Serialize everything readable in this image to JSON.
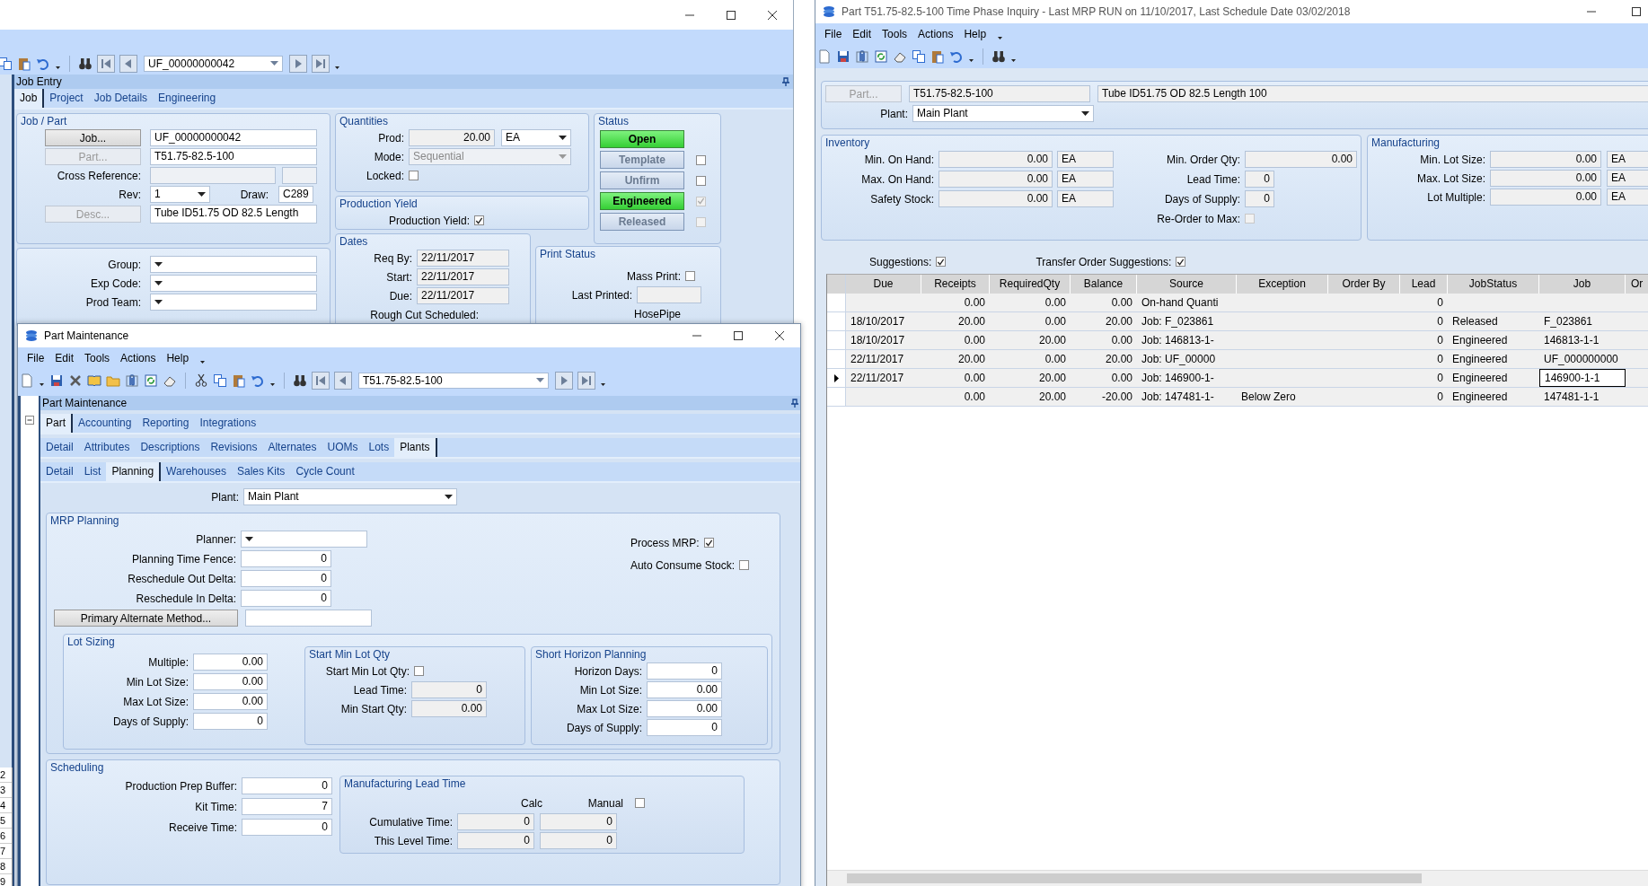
{
  "desktop": {
    "sheet_rows": [
      "2",
      "3",
      "4",
      "5",
      "6",
      "7",
      "8",
      "9"
    ]
  },
  "job_entry": {
    "record": "UF_00000000042",
    "panel_title": "Job Entry",
    "tabs": [
      {
        "label": "Job",
        "selected": true
      },
      {
        "label": "Project",
        "selected": false
      },
      {
        "label": "Job Details",
        "selected": false
      },
      {
        "label": "Engineering",
        "selected": false
      }
    ],
    "job_part": {
      "title": "Job / Part",
      "job_button": "Job...",
      "job": "UF_00000000042",
      "part_button": "Part...",
      "part": "T51.75-82.5-100",
      "cross_reference_label": "Cross Reference:",
      "rev_label": "Rev:",
      "rev": "1",
      "draw_label": "Draw:",
      "draw": "C289",
      "desc_button": "Desc...",
      "desc": "Tube ID51.75 OD 82.5 Length"
    },
    "codes": [
      {
        "label": "Group:"
      },
      {
        "label": "Exp Code:"
      },
      {
        "label": "Prod Team:"
      }
    ],
    "quantities": {
      "title": "Quantities",
      "prod_label": "Prod:",
      "prod": "20.00",
      "uom": "EA",
      "mode_label": "Mode:",
      "mode": "Sequential",
      "locked_label": "Locked:",
      "locked": false
    },
    "production_yield": {
      "title": "Production Yield",
      "label": "Production Yield:",
      "checked": true
    },
    "dates": {
      "title": "Dates",
      "fields": [
        {
          "label": "Req By:",
          "value": "22/11/2017"
        },
        {
          "label": "Start:",
          "value": "22/11/2017"
        },
        {
          "label": "Due:",
          "value": "22/11/2017"
        }
      ],
      "rough_cut_label": "Rough Cut Scheduled:"
    },
    "status": {
      "title": "Status",
      "buttons": [
        {
          "kind": "plain",
          "label": "Open",
          "on": true
        },
        {
          "kind": "checkbox",
          "label": "Template",
          "on": false,
          "checked": false,
          "disabled": false
        },
        {
          "kind": "checkbox",
          "label": "Unfirm",
          "on": false,
          "checked": false,
          "disabled": false
        },
        {
          "kind": "checkbox",
          "label": "Engineered",
          "on": true,
          "checked": true,
          "disabled": true
        },
        {
          "kind": "checkbox",
          "label": "Released",
          "on": false,
          "checked": false,
          "disabled": true
        }
      ]
    },
    "print_status": {
      "title": "Print Status",
      "mass_print_label": "Mass Print:",
      "mass_print": false,
      "last_printed_label": "Last Printed:",
      "hosepipe_label": "HosePipe"
    }
  },
  "part_maintenance": {
    "title": "Part Maintenance",
    "menu": [
      "File",
      "Edit",
      "Tools",
      "Actions",
      "Help"
    ],
    "record": "T51.75-82.5-100",
    "panel_title": "Part Maintenance",
    "tab_rows": [
      [
        {
          "label": "Part",
          "selected": true
        },
        {
          "label": "Accounting",
          "selected": false
        },
        {
          "label": "Reporting",
          "selected": false
        },
        {
          "label": "Integrations",
          "selected": false
        }
      ],
      [
        {
          "label": "Detail",
          "selected": false
        },
        {
          "label": "Attributes",
          "selected": false
        },
        {
          "label": "Descriptions",
          "selected": false
        },
        {
          "label": "Revisions",
          "selected": false
        },
        {
          "label": "Alternates",
          "selected": false
        },
        {
          "label": "UOMs",
          "selected": false
        },
        {
          "label": "Lots",
          "selected": false
        },
        {
          "label": "Plants",
          "selected": true
        }
      ],
      [
        {
          "label": "Detail",
          "selected": false
        },
        {
          "label": "List",
          "selected": false
        },
        {
          "label": "Planning",
          "selected": true
        },
        {
          "label": "Warehouses",
          "selected": false
        },
        {
          "label": "Sales Kits",
          "selected": false
        },
        {
          "label": "Cycle Count",
          "selected": false
        }
      ]
    ],
    "plant_label": "Plant:",
    "plant": "Main Plant",
    "mrp": {
      "title": "MRP Planning",
      "planner_label": "Planner:",
      "fields": [
        {
          "label": "Planning Time Fence:",
          "value": "0"
        },
        {
          "label": "Reschedule Out Delta:",
          "value": "0"
        },
        {
          "label": "Reschedule In Delta:",
          "value": "0"
        }
      ],
      "alt_button": "Primary Alternate Method...",
      "checks": [
        {
          "label": "Process MRP:",
          "checked": true
        },
        {
          "label": "Auto Consume Stock:",
          "checked": false
        }
      ]
    },
    "lot_sizing": {
      "title": "Lot Sizing",
      "fields": [
        {
          "label": "Multiple:",
          "value": "0.00"
        },
        {
          "label": "Min Lot Size:",
          "value": "0.00"
        },
        {
          "label": "Max Lot Size:",
          "value": "0.00"
        },
        {
          "label": "Days of Supply:",
          "value": "0"
        }
      ]
    },
    "start_min": {
      "title": "Start Min Lot Qty",
      "check_label": "Start Min Lot Qty:",
      "checked": false,
      "fields": [
        {
          "label": "Lead Time:",
          "value": "0"
        },
        {
          "label": "Min Start Qty:",
          "value": "0.00"
        }
      ]
    },
    "short_horizon": {
      "title": "Short Horizon Planning",
      "fields": [
        {
          "label": "Horizon Days:",
          "value": "0"
        },
        {
          "label": "Min Lot Size:",
          "value": "0.00"
        },
        {
          "label": "Max Lot Size:",
          "value": "0.00"
        },
        {
          "label": "Days of Supply:",
          "value": "0"
        }
      ]
    },
    "scheduling": {
      "title": "Scheduling",
      "fields": [
        {
          "label": "Production Prep Buffer:",
          "value": "0"
        },
        {
          "label": "Kit Time:",
          "value": "7"
        },
        {
          "label": "Receive Time:",
          "value": "0"
        }
      ]
    },
    "mfg_lead_time": {
      "title": "Manufacturing Lead Time",
      "calc_label": "Calc",
      "manual_label": "Manual",
      "manual": false,
      "rows": [
        {
          "label": "Cumulative Time:",
          "calc": "0",
          "manual": "0"
        },
        {
          "label": "This Level Time:",
          "calc": "0",
          "manual": "0"
        }
      ]
    }
  },
  "time_phase": {
    "title": "Part T51.75-82.5-100 Time Phase Inquiry  - Last MRP RUN on 11/10/2017, Last Schedule Date  03/02/2018",
    "menu": [
      "File",
      "Edit",
      "Tools",
      "Actions",
      "Help"
    ],
    "part_button": "Part...",
    "part": "T51.75-82.5-100",
    "description": "Tube ID51.75 OD 82.5 Length 100",
    "plant_label": "Plant:",
    "plant": "Main Plant",
    "inventory": {
      "title": "Inventory",
      "qty_fields": [
        {
          "label": "Min. On Hand:",
          "value": "0.00",
          "uom": "EA"
        },
        {
          "label": "Max. On Hand:",
          "value": "0.00",
          "uom": "EA"
        },
        {
          "label": "Safety Stock:",
          "value": "0.00",
          "uom": "EA"
        }
      ],
      "other_fields": [
        {
          "label": "Min. Order Qty:",
          "value": "0.00"
        },
        {
          "label": "Lead Time:",
          "value": "0"
        },
        {
          "label": "Days of Supply:",
          "value": "0"
        }
      ],
      "reorder_label": "Re-Order to Max:",
      "reorder": false
    },
    "manufacturing": {
      "title": "Manufacturing",
      "fields": [
        {
          "label": "Min. Lot Size:",
          "value": "0.00",
          "uom": "EA"
        },
        {
          "label": "Max. Lot Size:",
          "value": "0.00",
          "uom": "EA"
        },
        {
          "label": "Lot Multiple:",
          "value": "0.00",
          "uom": "EA"
        }
      ]
    },
    "suggestions": [
      {
        "label": "Suggestions:",
        "checked": true
      },
      {
        "label": "Transfer Order Suggestions:",
        "checked": true
      }
    ],
    "table": {
      "columns": [
        "Due",
        "Receipts",
        "RequiredQty",
        "Balance",
        "Source",
        "Exception",
        "Order By",
        "Lead",
        "JobStatus",
        "Job",
        "Or"
      ],
      "rows": [
        {
          "selected": false,
          "cells": [
            null,
            "0.00",
            "0.00",
            "0.00",
            "On-hand Quanti",
            null,
            null,
            "0",
            null,
            null
          ]
        },
        {
          "selected": false,
          "cells": [
            "18/10/2017",
            "20.00",
            "0.00",
            "20.00",
            "Job: F_023861",
            null,
            null,
            "0",
            "Released",
            "F_023861"
          ]
        },
        {
          "selected": false,
          "cells": [
            "18/10/2017",
            "0.00",
            "20.00",
            "0.00",
            "Job: 146813-1-",
            null,
            null,
            "0",
            "Engineered",
            "146813-1-1"
          ]
        },
        {
          "selected": false,
          "cells": [
            "22/11/2017",
            "20.00",
            "0.00",
            "20.00",
            "Job: UF_00000",
            null,
            null,
            "0",
            "Engineered",
            "UF_000000000"
          ]
        },
        {
          "selected": true,
          "cells": [
            "22/11/2017",
            "0.00",
            "20.00",
            "0.00",
            "Job: 146900-1-",
            null,
            null,
            "0",
            "Engineered",
            "146900-1-1"
          ]
        },
        {
          "selected": false,
          "cells": [
            null,
            "0.00",
            "20.00",
            "-20.00",
            "Job: 147481-1-",
            "Below Zero",
            null,
            "0",
            "Engineered",
            "147481-1-1"
          ]
        }
      ]
    }
  }
}
